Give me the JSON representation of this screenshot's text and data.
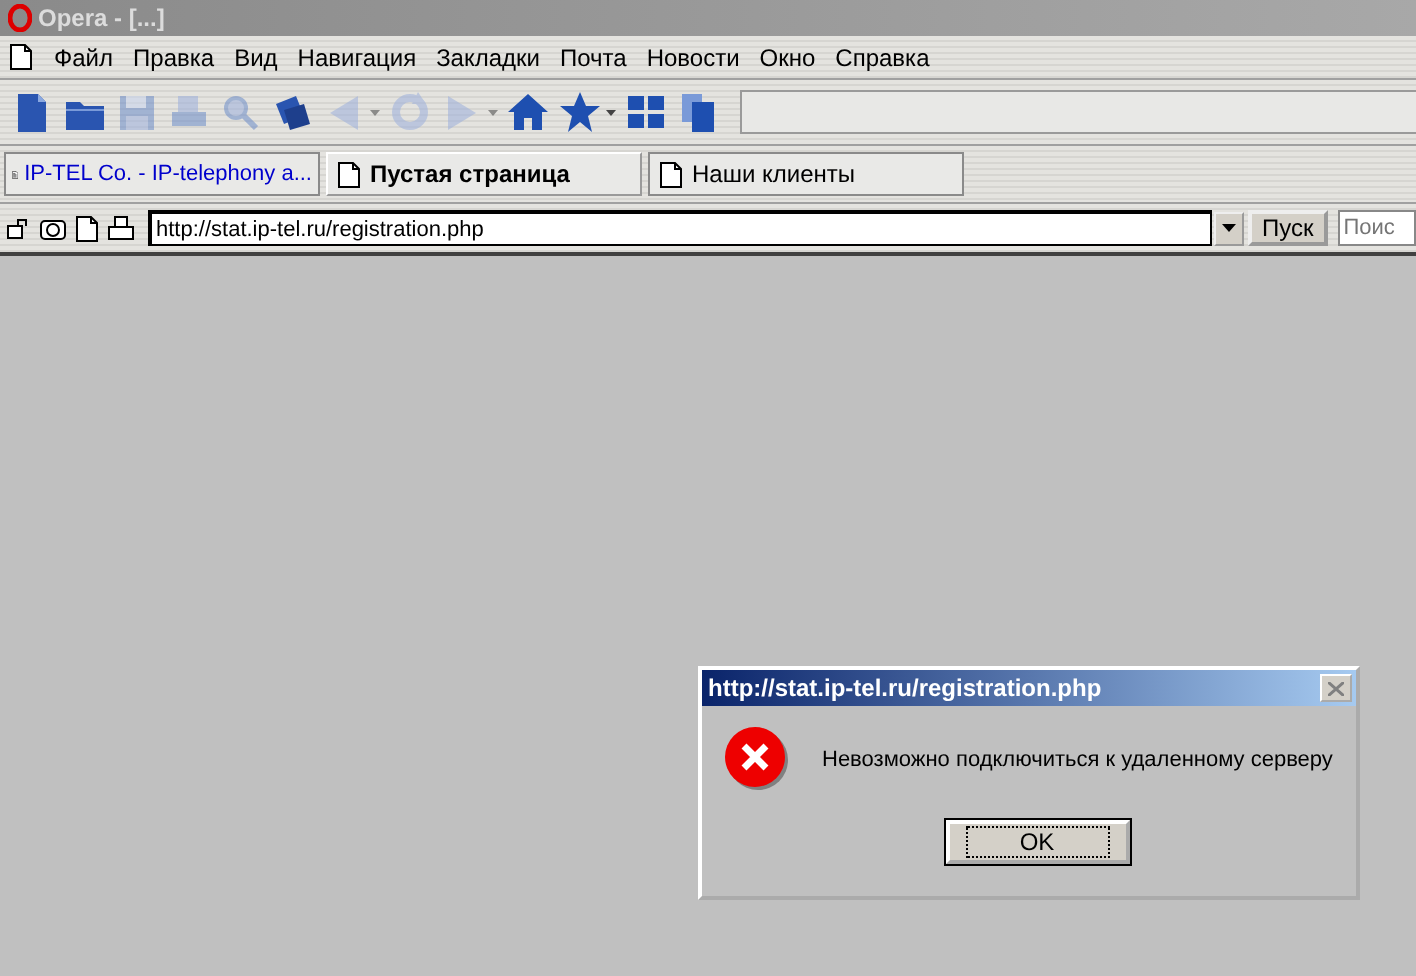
{
  "window": {
    "title": "Opera - [...]"
  },
  "menu": [
    "Файл",
    "Правка",
    "Вид",
    "Навигация",
    "Закладки",
    "Почта",
    "Новости",
    "Окно",
    "Справка"
  ],
  "toolbar": [
    {
      "disabled": false,
      "has_menu": false
    },
    {
      "disabled": false,
      "has_menu": false
    },
    {
      "disabled": true,
      "has_menu": false
    },
    {
      "disabled": true,
      "has_menu": false
    },
    {
      "disabled": true,
      "has_menu": false
    },
    {
      "disabled": false,
      "has_menu": false
    },
    {
      "disabled": true,
      "has_menu": true
    },
    {
      "disabled": true,
      "has_menu": false
    },
    {
      "disabled": true,
      "has_menu": true
    },
    {
      "disabled": false,
      "has_menu": false
    },
    {
      "disabled": false,
      "has_menu": true
    },
    {
      "disabled": false,
      "has_menu": false
    },
    {
      "disabled": false,
      "has_menu": false
    }
  ],
  "tabs": [
    {
      "label": "IP-TEL Co. - IP-telephony a...",
      "selected": false,
      "kind": "page"
    },
    {
      "label": "Пустая страница",
      "selected": true,
      "kind": "blank"
    },
    {
      "label": "Наши клиенты",
      "selected": false,
      "kind": "blank"
    }
  ],
  "address_bar": {
    "url": "http://stat.ip-tel.ru/registration.php",
    "go_button": "Пуск",
    "search_placeholder": "Поис"
  },
  "dialog": {
    "title": "http://stat.ip-tel.ru/registration.php",
    "message": "Невозможно подключиться к удаленному серверу",
    "button": "OK"
  }
}
